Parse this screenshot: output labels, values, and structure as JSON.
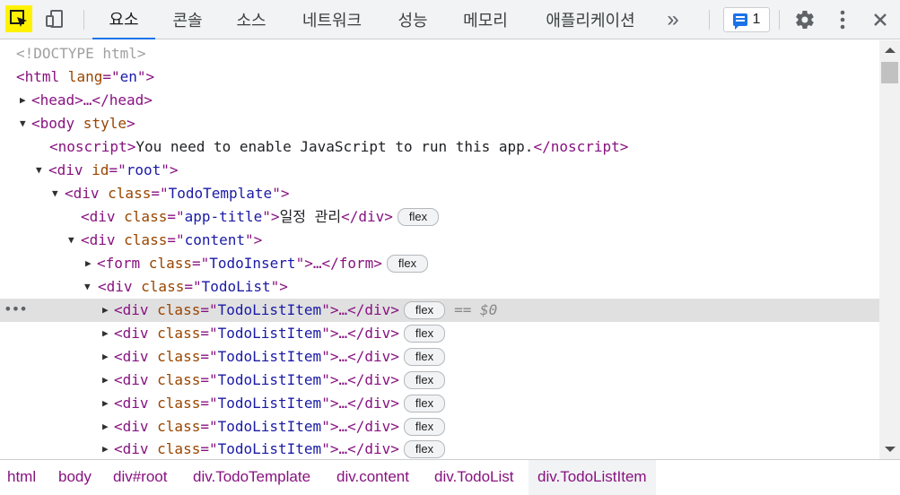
{
  "toolbar": {
    "tabs": [
      {
        "label": "요소"
      },
      {
        "label": "콘솔"
      },
      {
        "label": "소스"
      },
      {
        "label": "네트워크"
      },
      {
        "label": "성능"
      },
      {
        "label": "메모리"
      },
      {
        "label": "애플리케이션"
      }
    ],
    "more_tabs": "»",
    "issues_count": "1",
    "accent_color": "#1a73e8",
    "inspect_highlight": "#fff200"
  },
  "tree": {
    "doctype": "<!DOCTYPE html>",
    "html_open": "<html",
    "html_attr": " lang",
    "html_eq": "=\"",
    "html_val": "en",
    "html_close": "\">",
    "head": "<head>…</head>",
    "body_open": "<body",
    "body_attr": " style",
    "body_close": ">",
    "noscript_open": "<noscript>",
    "noscript_text": "You need to enable JavaScript to run this app.",
    "noscript_close": "</noscript>",
    "div_open": "<div",
    "id_attr": " id",
    "class_attr": " class",
    "eq": "=\"",
    "q_close": "\">",
    "root_val": "root",
    "template_val": "TodoTemplate",
    "app_title_val": "app-title",
    "app_title_text": "일정 관리",
    "div_end": "</div>",
    "content_val": "content",
    "form_open": "<form",
    "insert_val": "TodoInsert",
    "form_tail": "\">…</form>",
    "list_val": "TodoList",
    "item_val": "TodoListItem",
    "item_tail": "\">…</div>",
    "flex": "flex",
    "selected_marker": "== $0"
  },
  "breadcrumbs": [
    {
      "label": "html"
    },
    {
      "label": "body"
    },
    {
      "label": "div#root"
    },
    {
      "label": "div.TodoTemplate"
    },
    {
      "label": "div.content"
    },
    {
      "label": "div.TodoList"
    },
    {
      "label": "div.TodoListItem"
    }
  ]
}
